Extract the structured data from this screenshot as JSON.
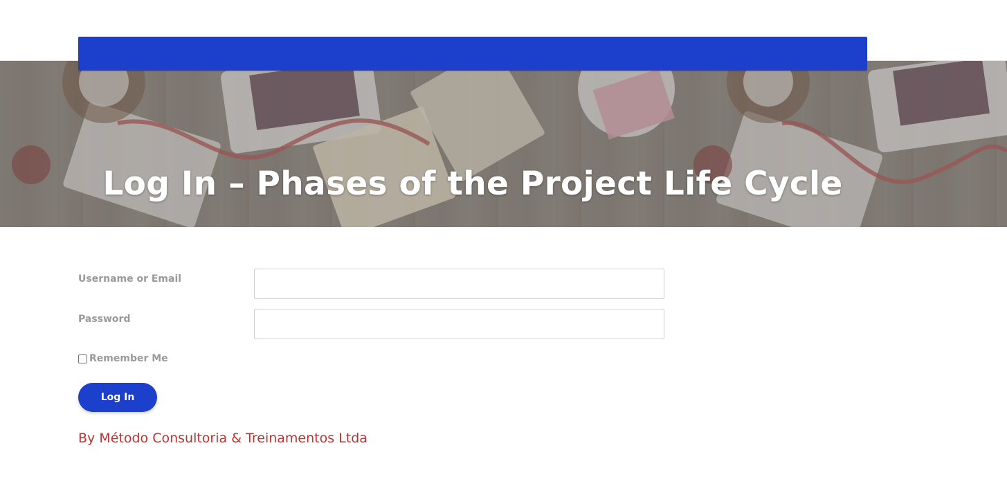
{
  "header": {
    "accent_color": "#1c3fcc"
  },
  "hero": {
    "title": "Log In – Phases of the Project Life Cycle"
  },
  "form": {
    "username_label": "Username or Email",
    "username_value": "",
    "password_label": "Password",
    "password_value": "",
    "remember_label": "Remember Me",
    "remember_checked": false,
    "submit_label": "Log In"
  },
  "footer": {
    "byline": "By Método Consultoria & Treinamentos Ltda",
    "byline_color": "#c0302e"
  }
}
